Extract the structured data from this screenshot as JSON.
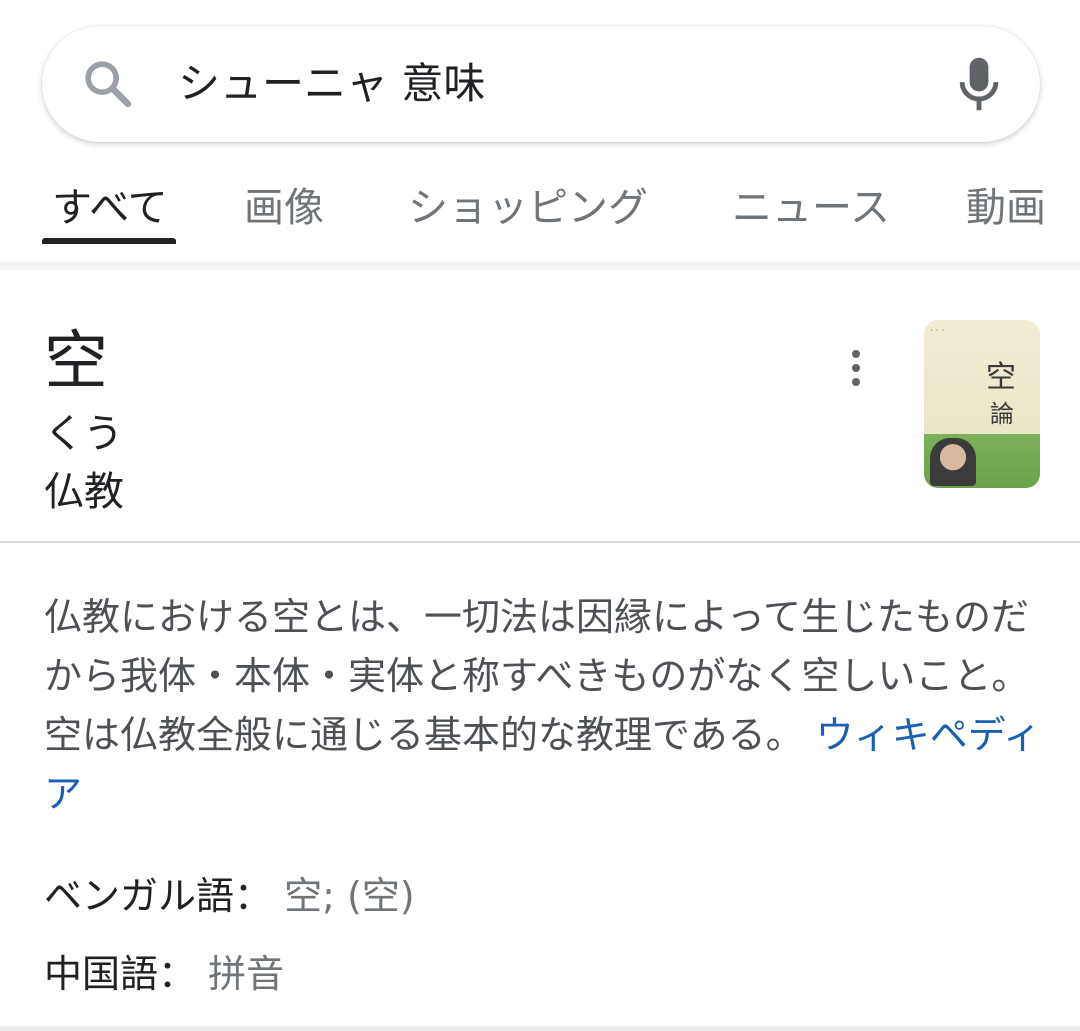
{
  "search": {
    "query": "シューニャ 意味",
    "icons": {
      "search": "search-icon",
      "mic": "mic-icon"
    }
  },
  "tabs": [
    {
      "label": "すべて",
      "active": true
    },
    {
      "label": "画像",
      "active": false
    },
    {
      "label": "ショッピング",
      "active": false
    },
    {
      "label": "ニュース",
      "active": false
    },
    {
      "label": "動画",
      "active": false
    }
  ],
  "entry": {
    "headword": "空",
    "reading": "くう",
    "category": "仏教",
    "more_icon": "more-vert-icon",
    "thumbnail": {
      "title_line1": "空",
      "title_line2": "論"
    }
  },
  "description": {
    "text": "仏教における空とは、一切法は因縁によって生じたものだから我体・本体・実体と称すべきものがなく空しいこと。空は仏教全般に通じる基本的な教理である。 ",
    "source_link": "ウィキペディア"
  },
  "languages": [
    {
      "label": "ベンガル語：",
      "value": "空; (空)"
    },
    {
      "label": "中国語：",
      "value": "拼音"
    }
  ],
  "colors": {
    "link": "#1a5fb4",
    "text_primary": "#202124",
    "text_secondary": "#70757a",
    "description": "#4d5156"
  }
}
